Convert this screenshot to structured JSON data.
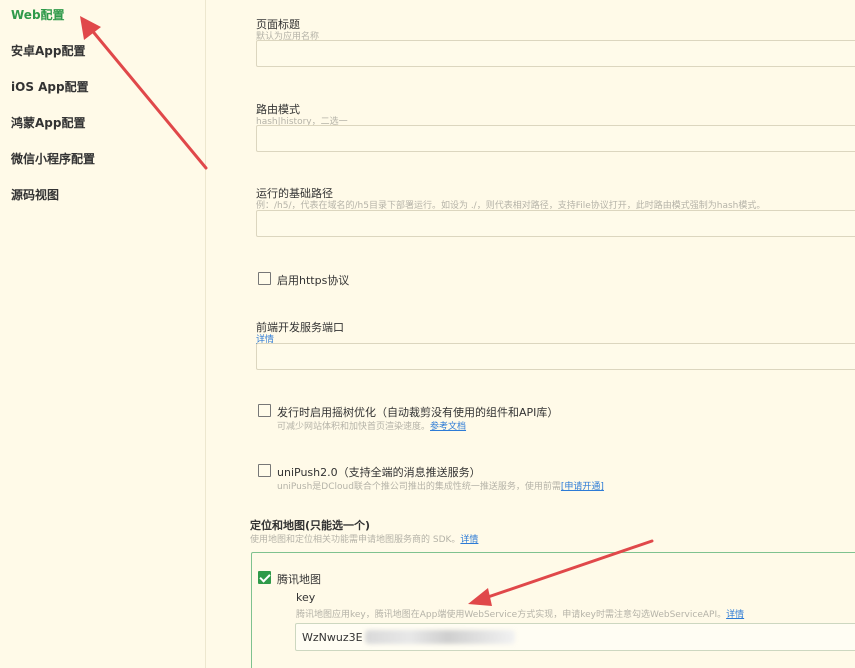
{
  "sidebar": {
    "items": [
      {
        "label": "Web配置",
        "active": true
      },
      {
        "label": "安卓App配置"
      },
      {
        "label": "iOS App配置"
      },
      {
        "label": "鸿蒙App配置"
      },
      {
        "label": "微信小程序配置"
      },
      {
        "label": "源码视图"
      }
    ]
  },
  "form": {
    "page_title": {
      "label": "页面标题",
      "hint": "默认为应用名称",
      "value": ""
    },
    "router_mode": {
      "label": "路由模式",
      "hint": "hash|history，二选一",
      "value": ""
    },
    "base_path": {
      "label": "运行的基础路径",
      "hint": "例：/h5/，代表在域名的/h5目录下部署运行。如设为 ./，则代表相对路径，支持File协议打开，此时路由模式强制为hash模式。",
      "value": ""
    },
    "https": {
      "label": "启用https协议",
      "checked": false
    },
    "dev_port": {
      "label": "前端开发服务端口",
      "link": "详情",
      "value": ""
    },
    "tree_shaking": {
      "label": "发行时启用摇树优化（自动裁剪没有使用的组件和API库）",
      "hint": "可减少网站体积和加快首页渲染速度。",
      "link": "参考文档",
      "checked": false
    },
    "unipush": {
      "label": "uniPush2.0（支持全端的消息推送服务）",
      "hint": "uniPush是DCloud联合个推公司推出的集成性统一推送服务，使用前需",
      "link": "[申请开通]",
      "checked": false
    }
  },
  "map_section": {
    "title": "定位和地图(只能选一个)",
    "hint": "使用地图和定位相关功能需申请地图服务商的 SDK。",
    "link": "详情",
    "tencent": {
      "label": "腾讯地图",
      "checked": true,
      "key_label": "key",
      "key_hint": "腾讯地图应用key，腾讯地图在App端使用WebService方式实现，申请key时需注意勾选WebServiceAPI。",
      "key_link": "详情",
      "key_value": "WzNwuz3E"
    }
  },
  "colors": {
    "accent": "#2f9a4a",
    "link": "#2d7bd6",
    "arrow": "#e0484a",
    "background": "#fffae8"
  }
}
